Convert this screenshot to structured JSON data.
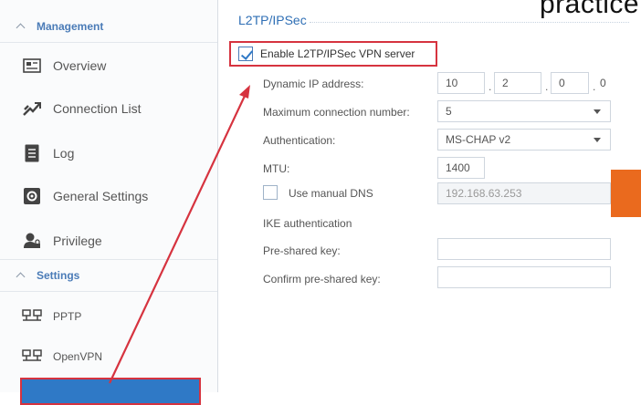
{
  "overlay_text": "practice",
  "sidebar": {
    "management": {
      "label": "Management",
      "items": [
        {
          "label": "Overview",
          "icon": "overview-icon"
        },
        {
          "label": "Connection List",
          "icon": "connection-list-icon"
        },
        {
          "label": "Log",
          "icon": "log-icon"
        },
        {
          "label": "General Settings",
          "icon": "gear-icon"
        },
        {
          "label": "Privilege",
          "icon": "privilege-icon"
        }
      ]
    },
    "settings": {
      "label": "Settings",
      "items": [
        {
          "label": "PPTP",
          "icon": "pptp-icon"
        },
        {
          "label": "OpenVPN",
          "icon": "openvpn-icon"
        }
      ]
    }
  },
  "main": {
    "title": "L2TP/IPSec",
    "enable": {
      "label": "Enable L2TP/IPSec VPN server",
      "checked": true
    },
    "dynamic_ip": {
      "label": "Dynamic IP address:",
      "octets": [
        "10",
        "2",
        "0",
        "0"
      ]
    },
    "max_conn": {
      "label": "Maximum connection number:",
      "value": "5"
    },
    "auth": {
      "label": "Authentication:",
      "value": "MS-CHAP v2"
    },
    "mtu": {
      "label": "MTU:",
      "value": "1400"
    },
    "manual_dns": {
      "label": "Use manual DNS",
      "checked": false,
      "value": "192.168.63.253"
    },
    "ike": {
      "label": "IKE authentication"
    },
    "psk": {
      "label": "Pre-shared key:",
      "value": ""
    },
    "confirm_psk": {
      "label": "Confirm pre-shared key:",
      "value": ""
    }
  },
  "colors": {
    "accent": "#2f79c6",
    "highlight": "#d6333f",
    "orange": "#ea6a1e"
  }
}
